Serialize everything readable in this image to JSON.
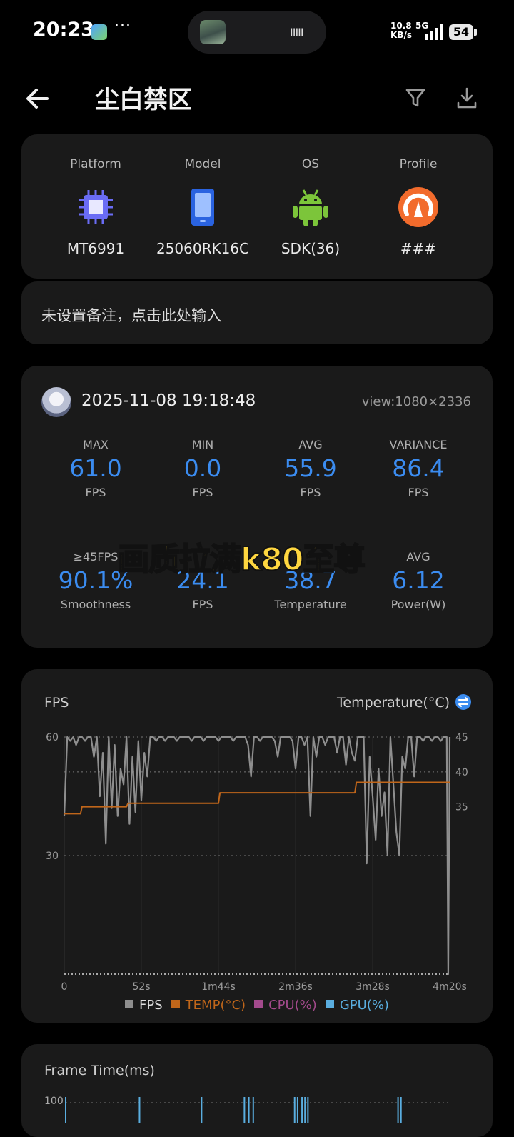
{
  "status_bar": {
    "time": "20:23",
    "dots": "···",
    "island_bars": "IIIII",
    "net_speed": "10.8\nKB/s",
    "network": "5G",
    "battery": "54"
  },
  "header": {
    "title": "尘白禁区"
  },
  "device": [
    {
      "label": "Platform",
      "value": "MT6991",
      "icon": "chip-icon"
    },
    {
      "label": "Model",
      "value": "25060RK16C",
      "icon": "phone-icon"
    },
    {
      "label": "OS",
      "value": "SDK(36)",
      "icon": "android-icon"
    },
    {
      "label": "Profile",
      "value": "###",
      "icon": "gauge-icon"
    }
  ],
  "note": {
    "text": "未设置备注，点击此处输入"
  },
  "record": {
    "datetime": "2025-11-08 19:18:48",
    "view": "view:1080×2336"
  },
  "metrics_row1": [
    {
      "label": "MAX",
      "value": "61.0",
      "unit": "FPS"
    },
    {
      "label": "MIN",
      "value": "0.0",
      "unit": "FPS"
    },
    {
      "label": "AVG",
      "value": "55.9",
      "unit": "FPS"
    },
    {
      "label": "VARIANCE",
      "value": "86.4",
      "unit": "FPS"
    }
  ],
  "metrics_row2": [
    {
      "label": "≥45FPS",
      "value": "90.1%",
      "unit": "Smoothness"
    },
    {
      "label": "",
      "value": "24.1",
      "unit": "FPS"
    },
    {
      "label": "",
      "value": "38.7",
      "unit": "Temperature"
    },
    {
      "label": "AVG",
      "value": "6.12",
      "unit": "Power(W)"
    }
  ],
  "overlay_caption": "画质拉满k80至尊",
  "fps_chart": {
    "left_title": "FPS",
    "right_title": "Temperature(°C)"
  },
  "chart_data": {
    "type": "line",
    "x_ticks": [
      "0",
      "52s",
      "1m44s",
      "2m36s",
      "3m28s",
      "4m20s"
    ],
    "y_left_ticks": [
      "60",
      "30"
    ],
    "y_right_ticks": [
      "45",
      "40",
      "35"
    ],
    "xlim": [
      0,
      260
    ],
    "ylim_left": [
      0,
      60
    ],
    "ylim_right": [
      11,
      45
    ],
    "series": [
      {
        "name": "FPS",
        "color": "#8e8e8e",
        "axis": "left",
        "x": [
          0,
          2,
          4,
          6,
          8,
          10,
          12,
          14,
          16,
          18,
          20,
          22,
          24,
          26,
          28,
          30,
          32,
          34,
          36,
          38,
          40,
          42,
          44,
          46,
          48,
          50,
          52,
          54,
          56,
          58,
          60,
          62,
          64,
          66,
          68,
          70,
          72,
          74,
          76,
          78,
          80,
          82,
          84,
          86,
          88,
          90,
          92,
          94,
          96,
          98,
          100,
          102,
          104,
          106,
          108,
          110,
          112,
          114,
          116,
          118,
          120,
          122,
          124,
          126,
          128,
          130,
          132,
          134,
          136,
          138,
          140,
          142,
          144,
          146,
          148,
          150,
          152,
          154,
          156,
          158,
          160,
          162,
          164,
          166,
          168,
          170,
          172,
          174,
          176,
          178,
          180,
          182,
          184,
          186,
          188,
          190,
          192,
          194,
          196,
          198,
          200,
          202,
          204,
          206,
          208,
          210,
          212,
          214,
          216,
          218,
          220,
          222,
          224,
          226,
          228,
          230,
          232,
          234,
          236,
          238,
          240,
          242,
          244,
          246,
          248,
          250,
          252,
          254,
          256,
          258,
          259,
          260
        ],
        "values": [
          40,
          60,
          59,
          60,
          58,
          60,
          60,
          59,
          60,
          60,
          55,
          60,
          45,
          56,
          33,
          60,
          42,
          58,
          40,
          52,
          48,
          60,
          38,
          55,
          41,
          59,
          44,
          56,
          50,
          60,
          60,
          59,
          60,
          60,
          59,
          60,
          60,
          60,
          59,
          60,
          60,
          60,
          60,
          59,
          60,
          60,
          60,
          59,
          60,
          60,
          60,
          60,
          59,
          60,
          60,
          60,
          60,
          59,
          60,
          60,
          60,
          60,
          58,
          50,
          60,
          60,
          59,
          60,
          60,
          60,
          60,
          59,
          55,
          60,
          60,
          60,
          60,
          59,
          52,
          60,
          60,
          58,
          60,
          40,
          60,
          55,
          60,
          60,
          58,
          60,
          60,
          60,
          56,
          60,
          60,
          53,
          60,
          56,
          54,
          60,
          60,
          60,
          28,
          55,
          45,
          34,
          52,
          40,
          46,
          30,
          60,
          48,
          36,
          30,
          55,
          52,
          60,
          60,
          50,
          60,
          60,
          59,
          60,
          60,
          59,
          60,
          60,
          59,
          60,
          60,
          0,
          60
        ]
      },
      {
        "name": "TEMP(°C)",
        "color": "#c0661a",
        "axis": "right",
        "x": [
          0,
          11,
          12,
          42,
          43,
          104,
          105,
          196,
          197,
          260
        ],
        "values": [
          34,
          34,
          35,
          35,
          35.5,
          35.5,
          37,
          37,
          38.5,
          38.5
        ]
      },
      {
        "name": "CPU(%)",
        "color": "#a34a8c",
        "axis": "left",
        "x": [],
        "values": []
      },
      {
        "name": "GPU(%)",
        "color": "#5aaee0",
        "axis": "left",
        "x": [],
        "values": []
      }
    ],
    "grid": true,
    "legend_position": "bottom"
  },
  "frametime_chart": {
    "title": "Frame Time(ms)",
    "y_tick": "100",
    "color": "#5aaee0",
    "spike_x": [
      0,
      50,
      92,
      121,
      124,
      127,
      155,
      157,
      160,
      162,
      164,
      225,
      227
    ]
  },
  "colors": {
    "accent": "#3b8cf0",
    "card": "#1a1a1a",
    "caption": "#ffd740"
  }
}
